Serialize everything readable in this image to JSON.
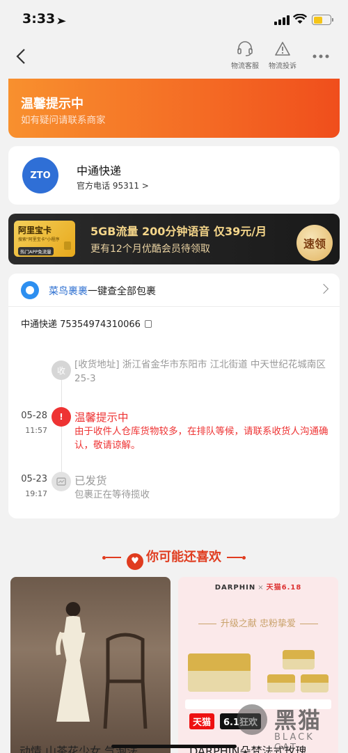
{
  "status_bar": {
    "time": "3:33"
  },
  "nav": {
    "service_label": "物流客服",
    "complaint_label": "物流投诉"
  },
  "banner": {
    "title": "温馨提示中",
    "subtitle": "如有疑问请联系商家"
  },
  "carrier": {
    "logo_text": "ZTO",
    "name": "中通快递",
    "phone": "官方电话 95311 >"
  },
  "ad": {
    "card_title": "阿里宝卡",
    "card_sub": "搜索\"阿里宝卡\"小程序",
    "card_tag": "热门APP免流量",
    "main": "5GB流量 200分钟语音 仅39元/月",
    "sub": "更有12个月优酷会员待领取",
    "button": "速领"
  },
  "tracking": {
    "cainiao_brand": "菜鸟裹裹",
    "cainiao_rest": "一键查全部包裹",
    "tracking_number": "中通快递 75354974310066",
    "events": [
      {
        "node": "收",
        "date": "",
        "time": "",
        "title": "",
        "body": "[收货地址] 浙江省金华市东阳市 江北街道 中天世纪花城南区 25-3"
      },
      {
        "node": "!",
        "date": "05-28",
        "time": "11:57",
        "title": "温馨提示中",
        "body": "由于收件人仓库货物较多，在排队等候，请联系收货人沟通确认，敬请谅解。"
      },
      {
        "node": "",
        "date": "05-23",
        "time": "19:17",
        "title": "已发货",
        "body": "包裹正在等待揽收"
      }
    ]
  },
  "recommend": {
    "title": "你可能还喜欢",
    "darphin_brand": "DARPHIN",
    "darphin_x": "×",
    "darphin_tmall": "天猫6.18",
    "darphin_slogan": "升级之献 忠粉挚爱",
    "tag_tmall": "天猫",
    "tag_618": "6.1狂欢",
    "left_title_partial": "动情 山茶花少女 气泡法",
    "right_title_partial": "DARPHIN朵梵法式玫瑰"
  },
  "watermark": {
    "text": "黑猫",
    "sub": "BLACK CAT"
  },
  "colors": {
    "accent": "#f46a24",
    "alert": "#e33333",
    "cainiao": "#2d6fd0"
  }
}
